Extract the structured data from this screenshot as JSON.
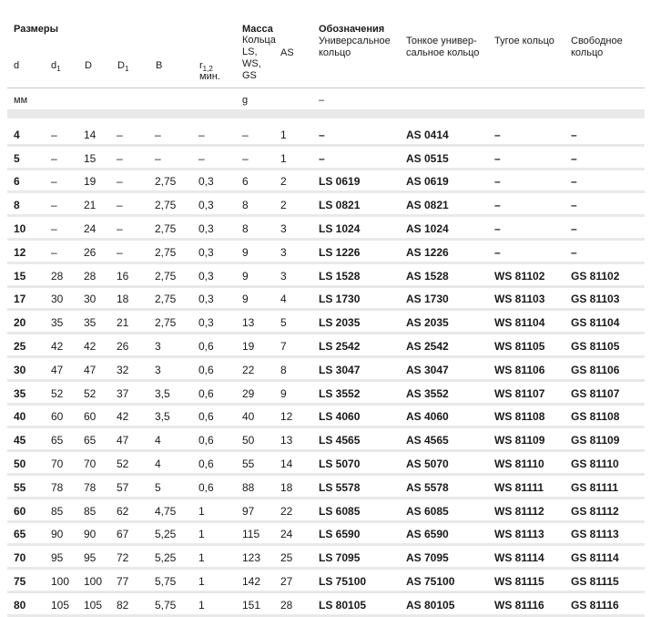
{
  "header": {
    "sizes": "Размеры",
    "mass": "Масса",
    "mass_rings": "Кольца",
    "mass_ring_types": "LS,",
    "mass_ring_types2": "WS,",
    "mass_ring_types3": "GS",
    "as": "AS",
    "designations": "Обозначения",
    "universal": "Универсальное",
    "universal2": "кольцо",
    "thin": "Тонкое универ-",
    "thin2": "сальное кольцо",
    "tight": "Тугое кольцо",
    "free": "Свободное",
    "free2": "кольцо",
    "col_d": "d",
    "col_d1": "d",
    "col_d1_sub": "1",
    "col_D": "D",
    "col_D1": "D",
    "col_D1_sub": "1",
    "col_B": "B",
    "col_r": "r",
    "col_r_sub": "1,2",
    "col_r_min": "мин.",
    "unit_mm": "мм",
    "unit_g": "g",
    "unit_dash": "–"
  },
  "rows": [
    [
      "4",
      "–",
      "14",
      "–",
      "–",
      "–",
      "–",
      "1",
      "–",
      "AS 0414",
      "–",
      "–"
    ],
    [
      "5",
      "–",
      "15",
      "–",
      "–",
      "–",
      "–",
      "1",
      "–",
      "AS 0515",
      "–",
      "–"
    ],
    [
      "6",
      "–",
      "19",
      "–",
      "2,75",
      "0,3",
      "6",
      "2",
      "LS 0619",
      "AS 0619",
      "–",
      "–"
    ],
    [
      "8",
      "–",
      "21",
      "–",
      "2,75",
      "0,3",
      "8",
      "2",
      "LS 0821",
      "AS 0821",
      "–",
      "–"
    ],
    [
      "10",
      "–",
      "24",
      "–",
      "2,75",
      "0,3",
      "8",
      "3",
      "LS 1024",
      "AS 1024",
      "–",
      "–"
    ],
    [
      "12",
      "–",
      "26",
      "–",
      "2,75",
      "0,3",
      "9",
      "3",
      "LS 1226",
      "AS 1226",
      "–",
      "–"
    ],
    [
      "15",
      "28",
      "28",
      "16",
      "2,75",
      "0,3",
      "9",
      "3",
      "LS 1528",
      "AS 1528",
      "WS 81102",
      "GS 81102"
    ],
    [
      "17",
      "30",
      "30",
      "18",
      "2,75",
      "0,3",
      "9",
      "4",
      "LS 1730",
      "AS 1730",
      "WS 81103",
      "GS 81103"
    ],
    [
      "20",
      "35",
      "35",
      "21",
      "2,75",
      "0,3",
      "13",
      "5",
      "LS 2035",
      "AS 2035",
      "WS 81104",
      "GS 81104"
    ],
    [
      "25",
      "42",
      "42",
      "26",
      "3",
      "0,6",
      "19",
      "7",
      "LS 2542",
      "AS 2542",
      "WS 81105",
      "GS 81105"
    ],
    [
      "30",
      "47",
      "47",
      "32",
      "3",
      "0,6",
      "22",
      "8",
      "LS 3047",
      "AS 3047",
      "WS 81106",
      "GS 81106"
    ],
    [
      "35",
      "52",
      "52",
      "37",
      "3,5",
      "0,6",
      "29",
      "9",
      "LS 3552",
      "AS 3552",
      "WS 81107",
      "GS 81107"
    ],
    [
      "40",
      "60",
      "60",
      "42",
      "3,5",
      "0,6",
      "40",
      "12",
      "LS 4060",
      "AS 4060",
      "WS 81108",
      "GS 81108"
    ],
    [
      "45",
      "65",
      "65",
      "47",
      "4",
      "0,6",
      "50",
      "13",
      "LS 4565",
      "AS 4565",
      "WS 81109",
      "GS 81109"
    ],
    [
      "50",
      "70",
      "70",
      "52",
      "4",
      "0,6",
      "55",
      "14",
      "LS 5070",
      "AS 5070",
      "WS 81110",
      "GS 81110"
    ],
    [
      "55",
      "78",
      "78",
      "57",
      "5",
      "0,6",
      "88",
      "18",
      "LS 5578",
      "AS 5578",
      "WS 81111",
      "GS 81111"
    ],
    [
      "60",
      "85",
      "85",
      "62",
      "4,75",
      "1",
      "97",
      "22",
      "LS 6085",
      "AS 6085",
      "WS 81112",
      "GS 81112"
    ],
    [
      "65",
      "90",
      "90",
      "67",
      "5,25",
      "1",
      "115",
      "24",
      "LS 6590",
      "AS 6590",
      "WS 81113",
      "GS 81113"
    ],
    [
      "70",
      "95",
      "95",
      "72",
      "5,25",
      "1",
      "123",
      "25",
      "LS 7095",
      "AS 7095",
      "WS 81114",
      "GS 81114"
    ],
    [
      "75",
      "100",
      "100",
      "77",
      "5,75",
      "1",
      "142",
      "27",
      "LS 75100",
      "AS 75100",
      "WS 81115",
      "GS 81115"
    ],
    [
      "80",
      "105",
      "105",
      "82",
      "5,75",
      "1",
      "151",
      "28",
      "LS 80105",
      "AS 80105",
      "WS 81116",
      "GS 81116"
    ]
  ]
}
